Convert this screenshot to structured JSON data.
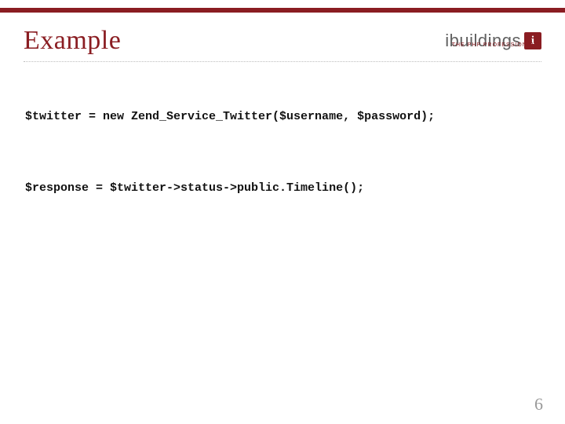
{
  "header": {
    "title": "Example",
    "logo_text": "ibuildings",
    "logo_symbol": "i",
    "tagline": "THE PHP PROFESSIONALS"
  },
  "code": {
    "line1": "$twitter = new Zend_Service_Twitter($username, $password);",
    "line2": "$response = $twitter->status->public.Timeline();"
  },
  "footer": {
    "page_number": "6"
  },
  "colors": {
    "accent": "#8a1d22",
    "text": "#111111",
    "muted": "#9a9a9a"
  }
}
